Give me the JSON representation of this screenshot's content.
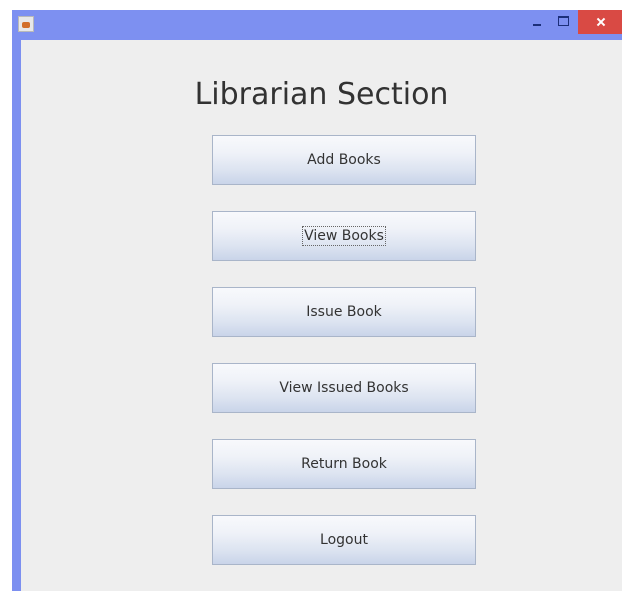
{
  "window": {
    "controls": {
      "minimize_icon": "minimize-icon",
      "maximize_icon": "maximize-icon",
      "close_icon": "close-icon"
    },
    "colors": {
      "titlebar": "#7d90f1",
      "close_button": "#d94a44",
      "content_background": "#eeeeee"
    }
  },
  "main": {
    "title": "Librarian Section",
    "buttons": [
      {
        "label": "Add Books"
      },
      {
        "label": "View Books"
      },
      {
        "label": "Issue Book"
      },
      {
        "label": "View Issued Books"
      },
      {
        "label": "Return Book"
      },
      {
        "label": "Logout"
      }
    ]
  }
}
